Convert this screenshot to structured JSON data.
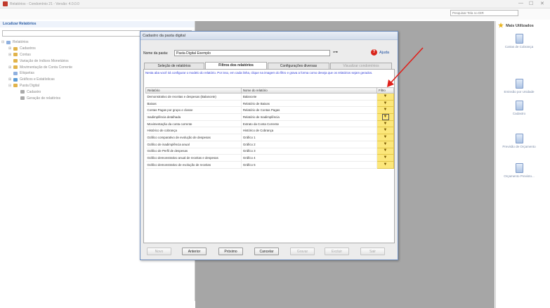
{
  "app": {
    "title": "Relatórios - Condomínio 21 - Versão: 4.0.0.0",
    "search_placeholder": "Pesquisar Tela no DIR"
  },
  "left_pane": {
    "header": "Localizar Relatórios",
    "tree": [
      {
        "label": "Relatórios",
        "level": 0,
        "expander": "⊟",
        "icon_color": "#8fb0df"
      },
      {
        "label": "Cadastros",
        "level": 1,
        "expander": "⊞",
        "icon_color": "#e1b34a"
      },
      {
        "label": "Contas",
        "level": 1,
        "expander": "⊞",
        "icon_color": "#e1b34a"
      },
      {
        "label": "Variação de índices Monetários",
        "level": 1,
        "expander": "",
        "icon_color": "#e1b34a"
      },
      {
        "label": "Movimentação de Conta Corrente",
        "level": 1,
        "expander": "⊞",
        "icon_color": "#e1b34a"
      },
      {
        "label": "Etiquetas",
        "level": 1,
        "expander": "",
        "icon_color": "#8fb0df"
      },
      {
        "label": "Gráficos e Estatísticas",
        "level": 1,
        "expander": "⊞",
        "icon_color": "#5c9bd6"
      },
      {
        "label": "Pasta Digital",
        "level": 1,
        "expander": "⊟",
        "icon_color": "#e1b34a"
      },
      {
        "label": "Cadastro",
        "level": 2,
        "expander": "",
        "icon_color": "#a9a9a9"
      },
      {
        "label": "Geração de relatórios",
        "level": 2,
        "expander": "",
        "icon_color": "#a9a9a9"
      }
    ]
  },
  "right_pane": {
    "header": "Mais Utilizados",
    "items": [
      {
        "label": "Cartas de Cobrança"
      },
      {
        "label": "Emissão por Unidade"
      },
      {
        "label": "Cadastro"
      },
      {
        "label": "Previsão de Orçamento"
      },
      {
        "label": "Orçamento Previsto..."
      }
    ]
  },
  "dialog": {
    "title": "Cadastro da pasta digital",
    "folder_label": "Nome da pasta:",
    "folder_value": "Pasta Digital Exemplo",
    "search_icon": "binoculars-icon",
    "help_label": "Ajuda",
    "tabs": [
      {
        "label": "Seleção de relatórios",
        "state": "normal"
      },
      {
        "label": "Filtros dos relatórios",
        "state": "active"
      },
      {
        "label": "Configurações diversas",
        "state": "normal"
      },
      {
        "label": "Visualizar condomínios",
        "state": "disabled"
      }
    ],
    "info_text": "Nesta aba você irá configurar o modelo do relatório. Por isso, em cada linha, clique na imagem do filtro e grava a forma como deseja que os relatórios sejam gerados.",
    "grid": {
      "columns": [
        "Relatório",
        "Nome do relatório",
        "Filtro"
      ],
      "rows": [
        {
          "report": "Demonstrativo de receitas e despesas (Balancete)",
          "name": "Balancete"
        },
        {
          "report": "Baixas",
          "name": "Relatório de Baixas"
        },
        {
          "report": "Contas Pagas por grupo e classe",
          "name": "Relatório de Contas Pagas"
        },
        {
          "report": "Inadimplência detalhada",
          "name": "Relatório de Inadimplência"
        },
        {
          "report": "Movimentação da conta corrente",
          "name": "Extrato da Conta Corrente"
        },
        {
          "report": "Histórico de cobrança",
          "name": "Histórico de Cobrança"
        },
        {
          "report": "Gráfico comparativo de evolução de despesas",
          "name": "Gráfico 1"
        },
        {
          "report": "Gráfico de inadimplência anual",
          "name": "Gráfico 2"
        },
        {
          "report": "Gráfico de Perfil de despesas",
          "name": "Gráfico 3"
        },
        {
          "report": "Gráfico demonstrativo anual de receitas e despesas",
          "name": "Gráfico 4"
        },
        {
          "report": "Gráfico demonstrativo de evolução de receitas",
          "name": "Gráfico 5"
        }
      ],
      "selected_filter_row": 3,
      "filter_icon": "funnel-icon",
      "filter_glyph": "▼"
    },
    "buttons": [
      {
        "label": "Novo",
        "enabled": false
      },
      {
        "label": "Anterior",
        "enabled": true
      },
      {
        "label": "Próximo",
        "enabled": true
      },
      {
        "label": "Cancelar",
        "enabled": true
      },
      {
        "label": "Gravar",
        "enabled": false
      },
      {
        "label": "Excluir",
        "enabled": false
      },
      {
        "label": "Sair",
        "enabled": false
      }
    ]
  },
  "colors": {
    "accent_blue": "#2b38d6",
    "filter_cell": "#fce77b",
    "annotation_arrow": "#e0201b",
    "workspace_gray": "#a6a6a6"
  }
}
